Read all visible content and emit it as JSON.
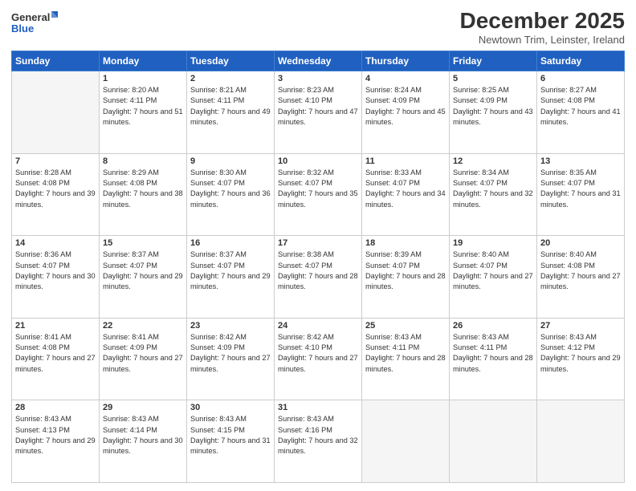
{
  "header": {
    "logo_line1": "General",
    "logo_line2": "Blue",
    "month_title": "December 2025",
    "subtitle": "Newtown Trim, Leinster, Ireland"
  },
  "days_of_week": [
    "Sunday",
    "Monday",
    "Tuesday",
    "Wednesday",
    "Thursday",
    "Friday",
    "Saturday"
  ],
  "weeks": [
    [
      {
        "day": "",
        "empty": true
      },
      {
        "day": "1",
        "sunrise": "8:20 AM",
        "sunset": "4:11 PM",
        "daylight": "7 hours and 51 minutes."
      },
      {
        "day": "2",
        "sunrise": "8:21 AM",
        "sunset": "4:11 PM",
        "daylight": "7 hours and 49 minutes."
      },
      {
        "day": "3",
        "sunrise": "8:23 AM",
        "sunset": "4:10 PM",
        "daylight": "7 hours and 47 minutes."
      },
      {
        "day": "4",
        "sunrise": "8:24 AM",
        "sunset": "4:09 PM",
        "daylight": "7 hours and 45 minutes."
      },
      {
        "day": "5",
        "sunrise": "8:25 AM",
        "sunset": "4:09 PM",
        "daylight": "7 hours and 43 minutes."
      },
      {
        "day": "6",
        "sunrise": "8:27 AM",
        "sunset": "4:08 PM",
        "daylight": "7 hours and 41 minutes."
      }
    ],
    [
      {
        "day": "7",
        "sunrise": "8:28 AM",
        "sunset": "4:08 PM",
        "daylight": "7 hours and 39 minutes."
      },
      {
        "day": "8",
        "sunrise": "8:29 AM",
        "sunset": "4:08 PM",
        "daylight": "7 hours and 38 minutes."
      },
      {
        "day": "9",
        "sunrise": "8:30 AM",
        "sunset": "4:07 PM",
        "daylight": "7 hours and 36 minutes."
      },
      {
        "day": "10",
        "sunrise": "8:32 AM",
        "sunset": "4:07 PM",
        "daylight": "7 hours and 35 minutes."
      },
      {
        "day": "11",
        "sunrise": "8:33 AM",
        "sunset": "4:07 PM",
        "daylight": "7 hours and 34 minutes."
      },
      {
        "day": "12",
        "sunrise": "8:34 AM",
        "sunset": "4:07 PM",
        "daylight": "7 hours and 32 minutes."
      },
      {
        "day": "13",
        "sunrise": "8:35 AM",
        "sunset": "4:07 PM",
        "daylight": "7 hours and 31 minutes."
      }
    ],
    [
      {
        "day": "14",
        "sunrise": "8:36 AM",
        "sunset": "4:07 PM",
        "daylight": "7 hours and 30 minutes."
      },
      {
        "day": "15",
        "sunrise": "8:37 AM",
        "sunset": "4:07 PM",
        "daylight": "7 hours and 29 minutes."
      },
      {
        "day": "16",
        "sunrise": "8:37 AM",
        "sunset": "4:07 PM",
        "daylight": "7 hours and 29 minutes."
      },
      {
        "day": "17",
        "sunrise": "8:38 AM",
        "sunset": "4:07 PM",
        "daylight": "7 hours and 28 minutes."
      },
      {
        "day": "18",
        "sunrise": "8:39 AM",
        "sunset": "4:07 PM",
        "daylight": "7 hours and 28 minutes."
      },
      {
        "day": "19",
        "sunrise": "8:40 AM",
        "sunset": "4:07 PM",
        "daylight": "7 hours and 27 minutes."
      },
      {
        "day": "20",
        "sunrise": "8:40 AM",
        "sunset": "4:08 PM",
        "daylight": "7 hours and 27 minutes."
      }
    ],
    [
      {
        "day": "21",
        "sunrise": "8:41 AM",
        "sunset": "4:08 PM",
        "daylight": "7 hours and 27 minutes."
      },
      {
        "day": "22",
        "sunrise": "8:41 AM",
        "sunset": "4:09 PM",
        "daylight": "7 hours and 27 minutes."
      },
      {
        "day": "23",
        "sunrise": "8:42 AM",
        "sunset": "4:09 PM",
        "daylight": "7 hours and 27 minutes."
      },
      {
        "day": "24",
        "sunrise": "8:42 AM",
        "sunset": "4:10 PM",
        "daylight": "7 hours and 27 minutes."
      },
      {
        "day": "25",
        "sunrise": "8:43 AM",
        "sunset": "4:11 PM",
        "daylight": "7 hours and 28 minutes."
      },
      {
        "day": "26",
        "sunrise": "8:43 AM",
        "sunset": "4:11 PM",
        "daylight": "7 hours and 28 minutes."
      },
      {
        "day": "27",
        "sunrise": "8:43 AM",
        "sunset": "4:12 PM",
        "daylight": "7 hours and 29 minutes."
      }
    ],
    [
      {
        "day": "28",
        "sunrise": "8:43 AM",
        "sunset": "4:13 PM",
        "daylight": "7 hours and 29 minutes."
      },
      {
        "day": "29",
        "sunrise": "8:43 AM",
        "sunset": "4:14 PM",
        "daylight": "7 hours and 30 minutes."
      },
      {
        "day": "30",
        "sunrise": "8:43 AM",
        "sunset": "4:15 PM",
        "daylight": "7 hours and 31 minutes."
      },
      {
        "day": "31",
        "sunrise": "8:43 AM",
        "sunset": "4:16 PM",
        "daylight": "7 hours and 32 minutes."
      },
      {
        "day": "",
        "empty": true
      },
      {
        "day": "",
        "empty": true
      },
      {
        "day": "",
        "empty": true
      }
    ]
  ]
}
